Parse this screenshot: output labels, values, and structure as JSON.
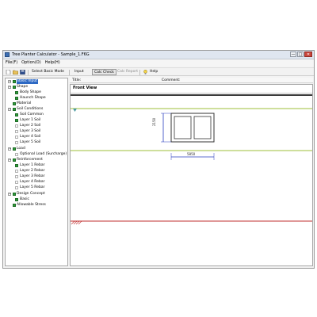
{
  "window": {
    "title": "Tree Planter Calculator - Sample_1.F6G",
    "controls": [
      "—",
      "□",
      "✕"
    ]
  },
  "menu": {
    "items": [
      "File(F)",
      "Option(O)",
      "Help(H)"
    ]
  },
  "toolbar": {
    "mode_button": "Select Basic Mode",
    "input_button": "Input",
    "calc_check_button": "Calc Check",
    "calc_report_button": "Calc Report",
    "help_button": "Help"
  },
  "tree": {
    "nodes": [
      {
        "label": "Basic Input",
        "level": 0,
        "expander": "−",
        "checked": true,
        "selected": true
      },
      {
        "label": "Shape",
        "level": 0,
        "expander": "−",
        "checked": true
      },
      {
        "label": "Body Shape",
        "level": 1,
        "checked": true
      },
      {
        "label": "Haunch Shape",
        "level": 1,
        "checked": true
      },
      {
        "label": "Material",
        "level": 0,
        "expander": "",
        "checked": true
      },
      {
        "label": "Soil Conditions",
        "level": 0,
        "expander": "−",
        "checked": true
      },
      {
        "label": "Soil Common",
        "level": 1,
        "checked": true
      },
      {
        "label": "Layer 1 Soil",
        "level": 1,
        "checked": true
      },
      {
        "label": "Layer 2 Soil",
        "level": 1,
        "checked": false
      },
      {
        "label": "Layer 3 Soil",
        "level": 1,
        "checked": false
      },
      {
        "label": "Layer 4 Soil",
        "level": 1,
        "checked": false
      },
      {
        "label": "Layer 5 Soil",
        "level": 1,
        "checked": false
      },
      {
        "label": "Load",
        "level": 0,
        "expander": "−",
        "checked": true
      },
      {
        "label": "Optional Load (Surcharge)",
        "level": 1,
        "checked": false
      },
      {
        "label": "Reinforcement",
        "level": 0,
        "expander": "−",
        "checked": true
      },
      {
        "label": "Layer 1 Rebar",
        "level": 1,
        "checked": true
      },
      {
        "label": "Layer 2 Rebar",
        "level": 1,
        "checked": false
      },
      {
        "label": "Layer 3 Rebar",
        "level": 1,
        "checked": false
      },
      {
        "label": "Layer 4 Rebar",
        "level": 1,
        "checked": false
      },
      {
        "label": "Layer 5 Rebar",
        "level": 1,
        "checked": false
      },
      {
        "label": "Design Concept",
        "level": 0,
        "expander": "−",
        "checked": true
      },
      {
        "label": "Basic",
        "level": 1,
        "checked": true
      },
      {
        "label": "Allowable Stress",
        "level": 0,
        "expander": "",
        "checked": true
      }
    ]
  },
  "info": {
    "title_label": "Title:",
    "comment_label": "Comment:"
  },
  "canvas": {
    "view_title": "Front View",
    "dim_height": "2150",
    "dim_width": "5850"
  },
  "colors": {
    "check_on": "#2e9e3a",
    "selection": "#2d69c4",
    "ground_line": "#9dbf3a",
    "water_line": "#c03030",
    "level_marker": "#4a9aa0",
    "dim_line": "#2a3fbf"
  },
  "icons": [
    "new-file-icon",
    "open-folder-icon",
    "save-icon",
    "help-bulb-icon"
  ]
}
